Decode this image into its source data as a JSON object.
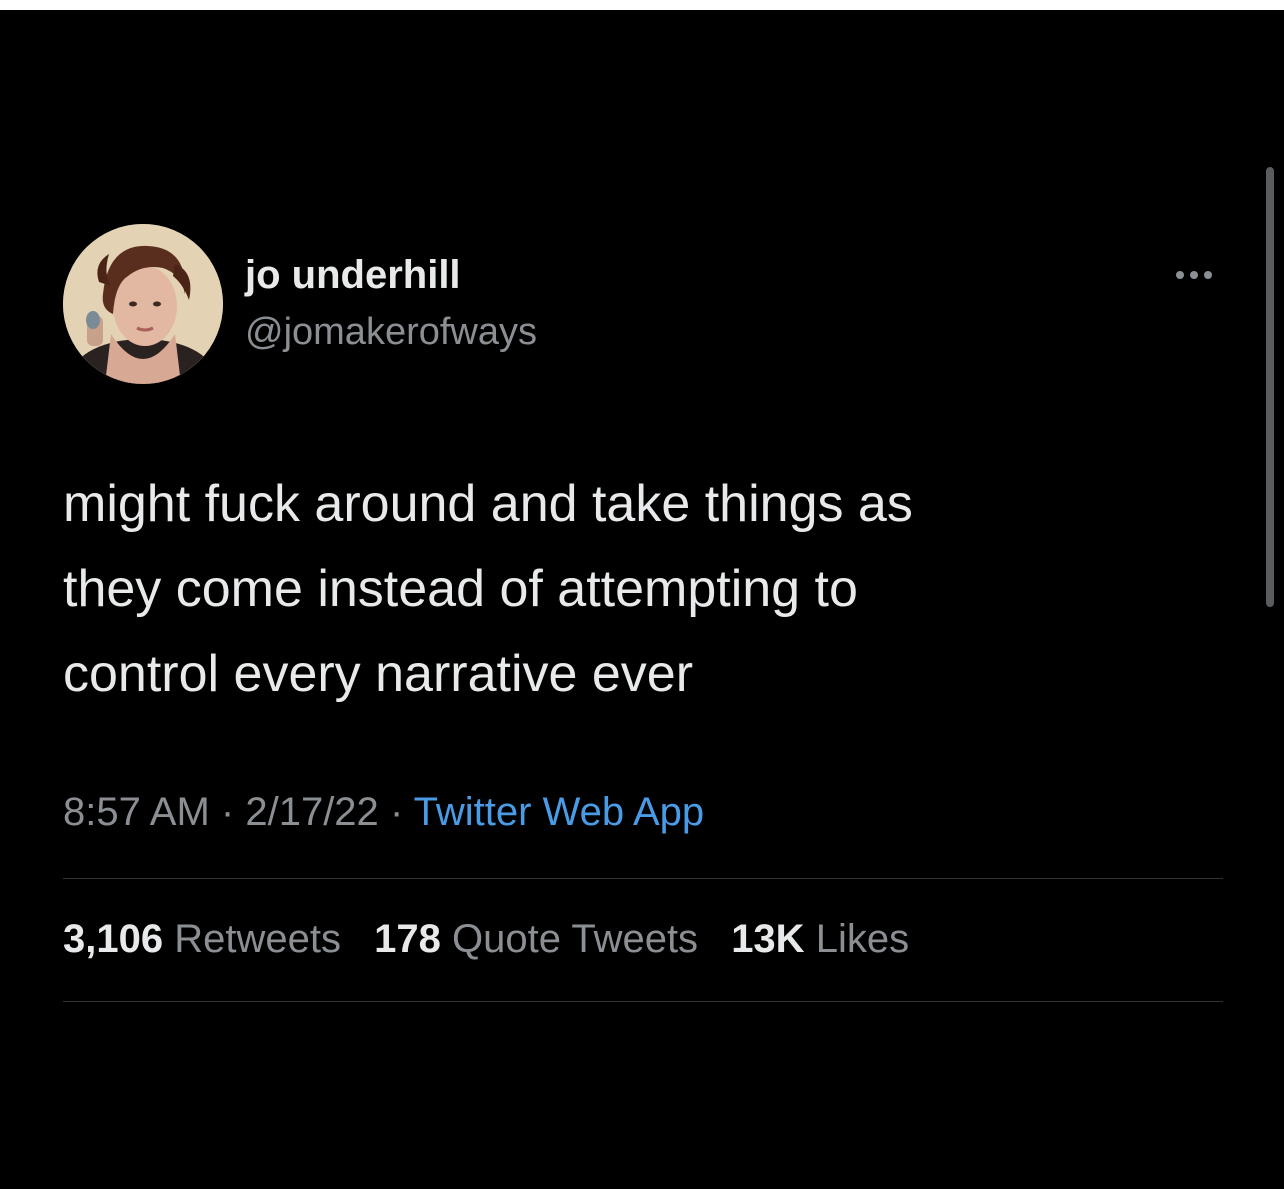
{
  "author": {
    "display_name": "jo underhill",
    "handle": "@jomakerofways"
  },
  "tweet": {
    "text_lines": [
      "might fuck around and take things as",
      "they come instead of attempting to",
      "control every narrative ever"
    ],
    "time": "8:57 AM",
    "date": "2/17/22",
    "separator": "·",
    "source": "Twitter Web App"
  },
  "stats": {
    "retweets_count": "3,106",
    "retweets_label": "Retweets",
    "quotes_count": "178",
    "quotes_label": "Quote Tweets",
    "likes_count": "13K",
    "likes_label": "Likes"
  },
  "icons": {
    "more": "more-options-icon"
  },
  "colors": {
    "background": "#000000",
    "primary_text": "#e7e9ea",
    "secondary_text": "#8b8f93",
    "link": "#4a9be6",
    "divider": "#2f3336"
  }
}
